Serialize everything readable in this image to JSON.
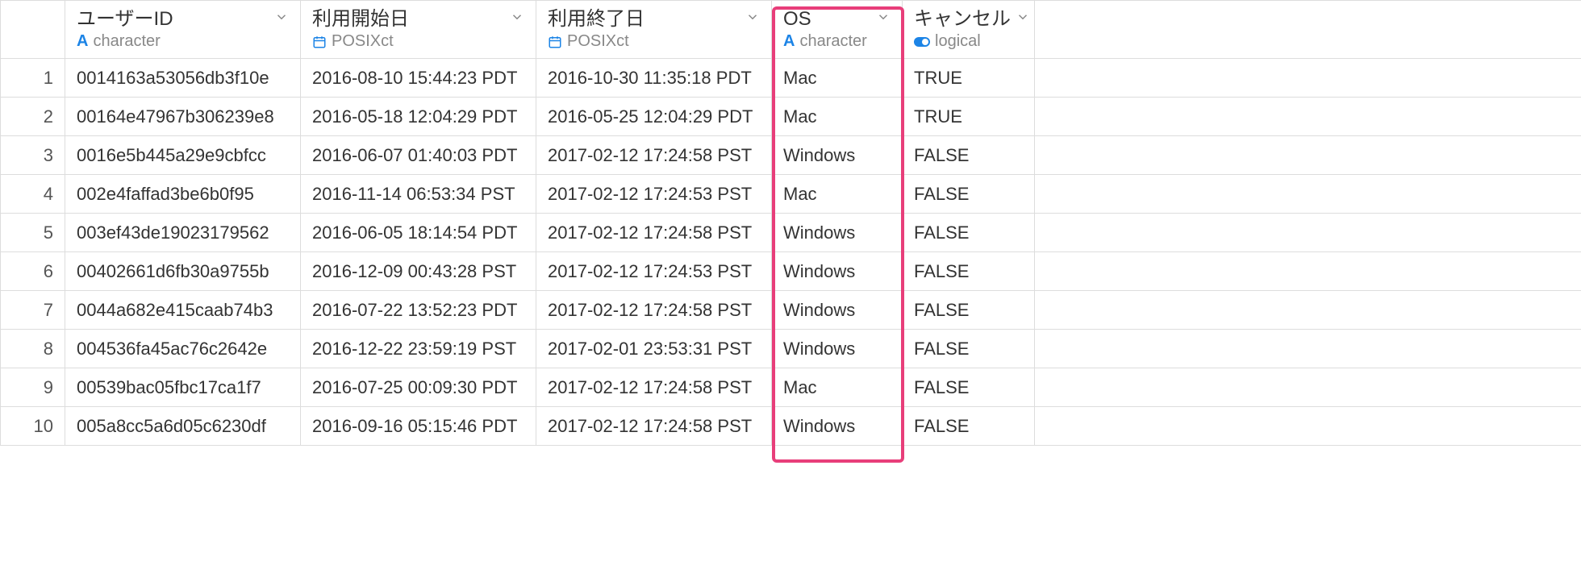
{
  "columns": {
    "user_id": {
      "title": "ユーザーID",
      "type": "character",
      "icon": "A"
    },
    "start": {
      "title": "利用開始日",
      "type": "POSIXct",
      "icon": "calendar"
    },
    "end": {
      "title": "利用終了日",
      "type": "POSIXct",
      "icon": "calendar"
    },
    "os": {
      "title": "OS",
      "type": "character",
      "icon": "A"
    },
    "cancel": {
      "title": "キャンセル",
      "type": "logical",
      "icon": "toggle"
    }
  },
  "rows": [
    {
      "n": "1",
      "user_id": "0014163a53056db3f10e",
      "start": "2016-08-10 15:44:23 PDT",
      "end": "2016-10-30 11:35:18 PDT",
      "os": "Mac",
      "cancel": "TRUE"
    },
    {
      "n": "2",
      "user_id": "00164e47967b306239e8",
      "start": "2016-05-18 12:04:29 PDT",
      "end": "2016-05-25 12:04:29 PDT",
      "os": "Mac",
      "cancel": "TRUE"
    },
    {
      "n": "3",
      "user_id": "0016e5b445a29e9cbfcc",
      "start": "2016-06-07 01:40:03 PDT",
      "end": "2017-02-12 17:24:58 PST",
      "os": "Windows",
      "cancel": "FALSE"
    },
    {
      "n": "4",
      "user_id": "002e4faffad3be6b0f95",
      "start": "2016-11-14 06:53:34 PST",
      "end": "2017-02-12 17:24:53 PST",
      "os": "Mac",
      "cancel": "FALSE"
    },
    {
      "n": "5",
      "user_id": "003ef43de19023179562",
      "start": "2016-06-05 18:14:54 PDT",
      "end": "2017-02-12 17:24:58 PST",
      "os": "Windows",
      "cancel": "FALSE"
    },
    {
      "n": "6",
      "user_id": "00402661d6fb30a9755b",
      "start": "2016-12-09 00:43:28 PST",
      "end": "2017-02-12 17:24:53 PST",
      "os": "Windows",
      "cancel": "FALSE"
    },
    {
      "n": "7",
      "user_id": "0044a682e415caab74b3",
      "start": "2016-07-22 13:52:23 PDT",
      "end": "2017-02-12 17:24:58 PST",
      "os": "Windows",
      "cancel": "FALSE"
    },
    {
      "n": "8",
      "user_id": "004536fa45ac76c2642e",
      "start": "2016-12-22 23:59:19 PST",
      "end": "2017-02-01 23:53:31 PST",
      "os": "Windows",
      "cancel": "FALSE"
    },
    {
      "n": "9",
      "user_id": "00539bac05fbc17ca1f7",
      "start": "2016-07-25 00:09:30 PDT",
      "end": "2017-02-12 17:24:58 PST",
      "os": "Mac",
      "cancel": "FALSE"
    },
    {
      "n": "10",
      "user_id": "005a8cc5a6d05c6230df",
      "start": "2016-09-16 05:15:46 PDT",
      "end": "2017-02-12 17:24:58 PST",
      "os": "Windows",
      "cancel": "FALSE"
    }
  ]
}
